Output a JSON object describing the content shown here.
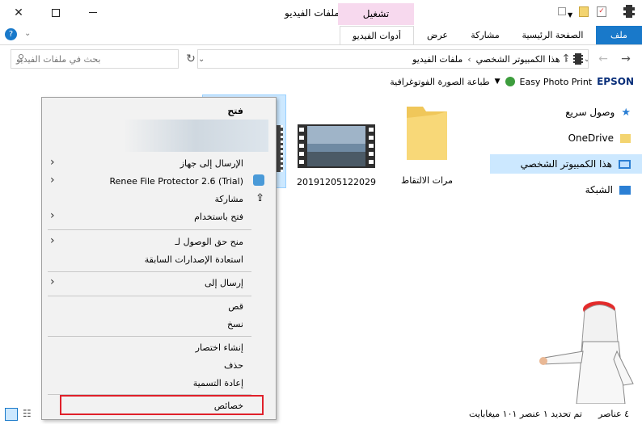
{
  "window": {
    "title": "ملفات الفيديو",
    "contextual_tab_group": "تشغيل"
  },
  "ribbon": {
    "tabs": [
      "ملف",
      "الصفحة الرئيسية",
      "مشاركة",
      "عرض",
      "أدوات الفيديو"
    ]
  },
  "address": {
    "path": [
      "هذا الكمبيوتر الشخصي",
      "ملفات الفيديو"
    ],
    "search_placeholder": "بحث في ملفات الفيديو"
  },
  "toolbar2": {
    "brand": "EPSON",
    "app": "Easy Photo Print",
    "action": "طباعة الصورة الفوتوغرافية"
  },
  "nav": {
    "items": [
      {
        "label": "وصول سريع",
        "icon": "star-icon"
      },
      {
        "label": "OneDrive",
        "icon": "folder-icon"
      },
      {
        "label": "هذا الكمبيوتر الشخصي",
        "icon": "computer-icon"
      },
      {
        "label": "الشبكة",
        "icon": "network-icon"
      }
    ],
    "selected_index": 2
  },
  "files": [
    {
      "name": "مرات الالتقاط",
      "type": "folder"
    },
    {
      "name": "20191205122029",
      "type": "video"
    }
  ],
  "context_menu": {
    "items": [
      {
        "label": "فتح",
        "bold": true
      },
      {
        "label": "الإرسال إلى جهاز",
        "submenu": true
      },
      {
        "label": "Renee File Protector 2.6 (Trial)",
        "submenu": true,
        "icon": "shield-app-icon"
      },
      {
        "label": "مشاركة",
        "icon": "share-icon"
      },
      {
        "label": "فتح باستخدام",
        "submenu": true
      },
      {
        "label": "منح حق الوصول لـ",
        "submenu": true
      },
      {
        "label": "استعادة الإصدارات السابقة"
      },
      {
        "label": "إرسال إلى",
        "submenu": true
      },
      {
        "label": "قص"
      },
      {
        "label": "نسخ"
      },
      {
        "label": "إنشاء اختصار"
      },
      {
        "label": "حذف"
      },
      {
        "label": "إعادة التسمية"
      },
      {
        "label": "خصائص",
        "highlighted": true
      }
    ]
  },
  "status": {
    "count": "٤ عناصر",
    "selection": "تم تحديد ١ عنصر ١٠١ ميغابايت"
  },
  "colors": {
    "accent": "#1979ca",
    "selection": "#cce8ff",
    "contextual": "#f7d9ee",
    "highlight_border": "#e0202a"
  }
}
